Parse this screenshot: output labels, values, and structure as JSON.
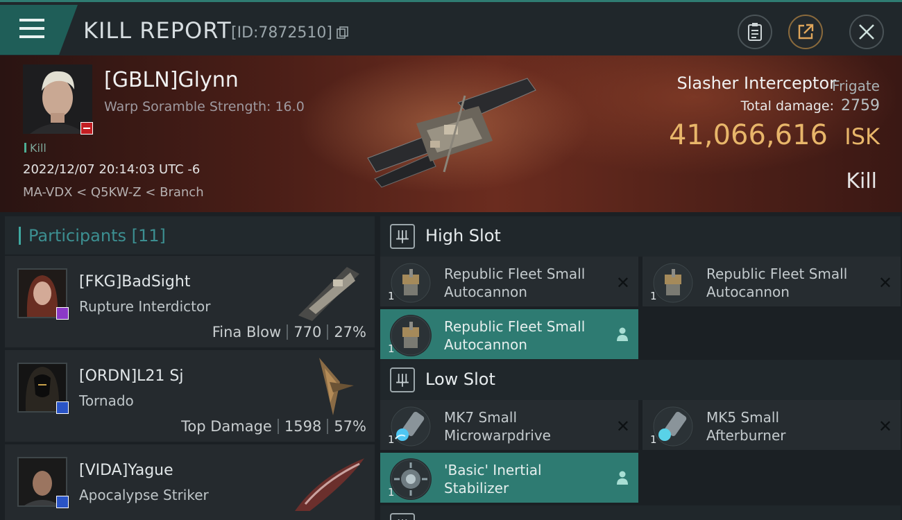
{
  "header": {
    "title": "KILL REPORT",
    "report_id": "[ID:7872510]",
    "icons": [
      "menu-icon",
      "clipboard-icon",
      "share-icon",
      "close-icon"
    ]
  },
  "victim": {
    "name": "[GBLN]Glynn",
    "scramble": "Warp Soramble Strength: 16.0",
    "tag": "Kill",
    "datetime": "2022/12/07 20:14:03 UTC -6",
    "route": "MA-VDX < Q5KW-Z < Branch",
    "ship": "Slasher Interceptor",
    "ship_class": "Frigate",
    "damage_label": "Total damage:",
    "damage": "2759",
    "isk": "41,066,616",
    "isk_unit": "ISK",
    "kind": "Kill"
  },
  "participants": {
    "label": "Participants",
    "count": "[11]",
    "rows": [
      {
        "name": "[FKG]BadSight",
        "ship": "Rupture Interdictor",
        "tag": "Fina Blow",
        "damage": "770",
        "pct": "27%",
        "badge_color": "#8b39c7"
      },
      {
        "name": "[ORDN]L21 Sj",
        "ship": "Tornado",
        "tag": "Top Damage",
        "damage": "1598",
        "pct": "57%",
        "badge_color": "#2a54c6"
      },
      {
        "name": "[VIDA]Yague",
        "ship": "Apocalypse Striker",
        "tag": "",
        "damage": "",
        "pct": "",
        "badge_color": "#2a54c6"
      }
    ]
  },
  "fitting": {
    "high_slot": "High Slot",
    "low_slot": "Low Slot",
    "high_items": [
      {
        "qty": "1",
        "line1": "Republic Fleet Small",
        "line2": "Autocannon",
        "state": "destroyed"
      },
      {
        "qty": "1",
        "line1": "Republic Fleet Small",
        "line2": "Autocannon",
        "state": "destroyed"
      },
      {
        "qty": "1",
        "line1": "Republic Fleet Small",
        "line2": "Autocannon",
        "state": "dropped"
      }
    ],
    "low_items": [
      {
        "qty": "1",
        "line1": "MK7 Small",
        "line2": "Microwarpdrive",
        "state": "destroyed"
      },
      {
        "qty": "1",
        "line1": "MK5 Small",
        "line2": "Afterburner",
        "state": "destroyed"
      },
      {
        "qty": "1",
        "line1": "'Basic' Inertial",
        "line2": "Stabilizer",
        "state": "dropped"
      }
    ]
  },
  "colors": {
    "accent": "#2e7b72",
    "isk": "#e8b66a",
    "panel": "#252a2e"
  }
}
